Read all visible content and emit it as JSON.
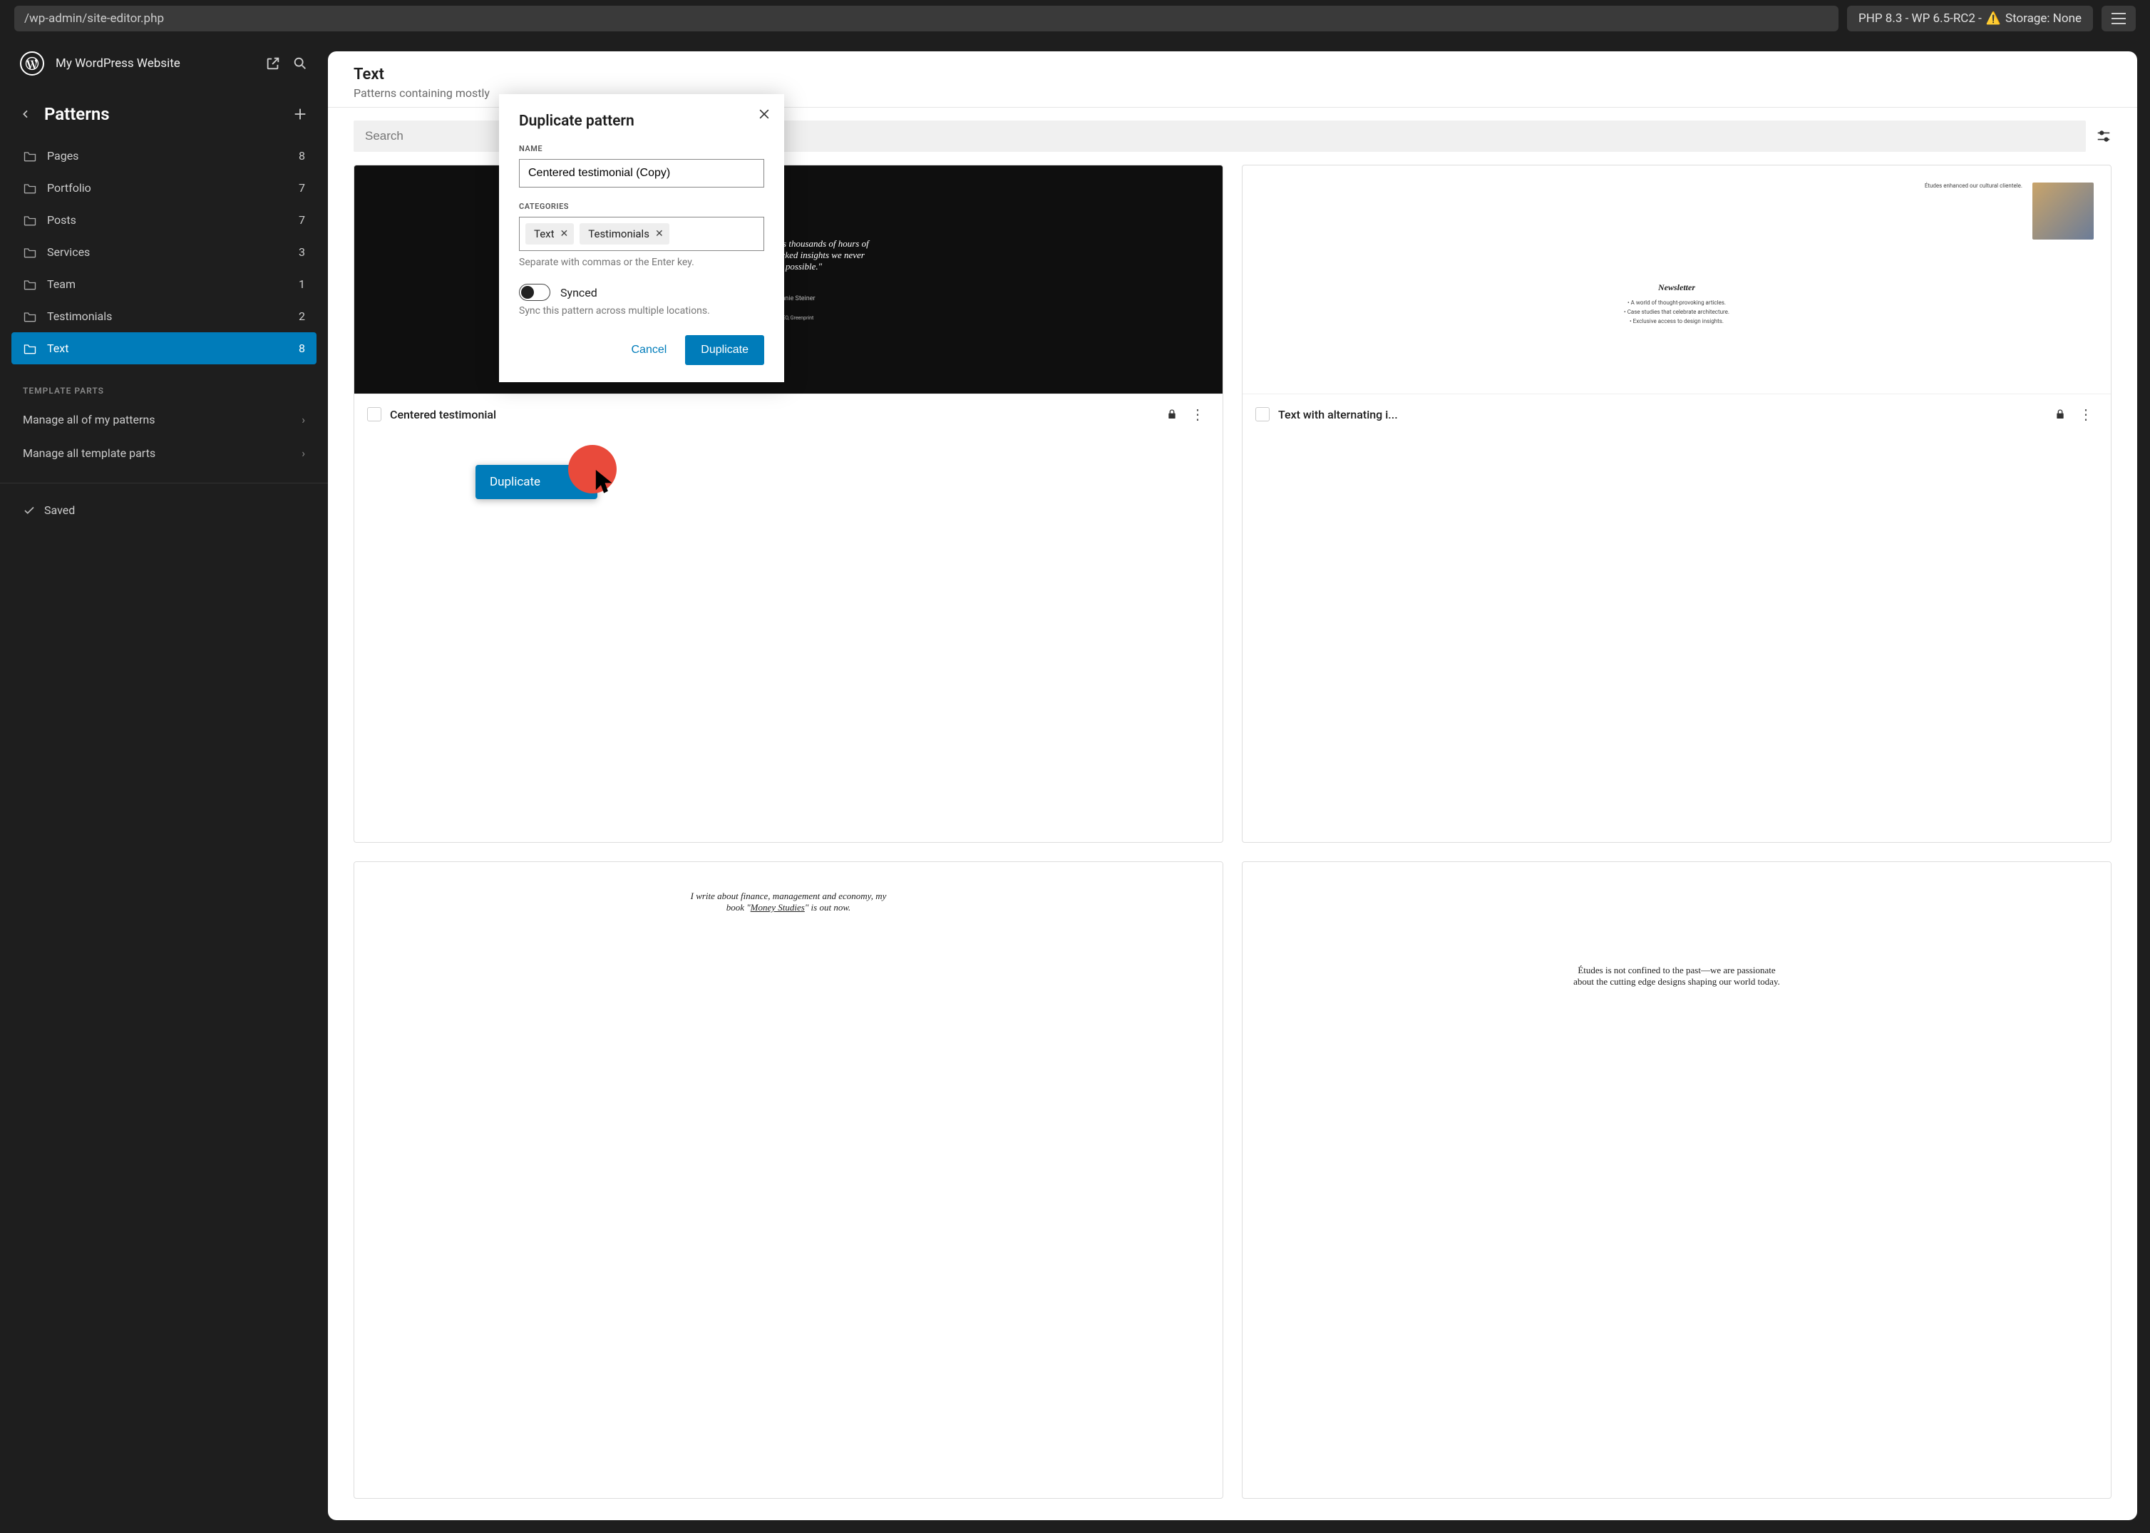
{
  "chrome": {
    "url": "/wp-admin/site-editor.php",
    "env": "PHP 8.3 - WP 6.5-RC2 - ",
    "env_warn": "⚠️",
    "env_storage": " Storage: None"
  },
  "sidebar": {
    "site_title": "My WordPress Website",
    "nav_title": "Patterns",
    "categories": [
      {
        "label": "Pages",
        "count": "8"
      },
      {
        "label": "Portfolio",
        "count": "7"
      },
      {
        "label": "Posts",
        "count": "7"
      },
      {
        "label": "Services",
        "count": "3"
      },
      {
        "label": "Team",
        "count": "1"
      },
      {
        "label": "Testimonials",
        "count": "2"
      },
      {
        "label": "Text",
        "count": "8"
      }
    ],
    "template_parts_title": "TEMPLATE PARTS",
    "manage_patterns": "Manage all of my patterns",
    "manage_template_parts": "Manage all template parts",
    "saved": "Saved"
  },
  "panel": {
    "title": "Text",
    "subtitle": "Patterns containing mostly",
    "search_placeholder": "Search",
    "cards": {
      "0": {
        "title": "Centered testimonial",
        "preview_quote": "\"Études has saved us thousands of hours of work and has unlocked insights we never thought possible.\"",
        "preview_author": "Annie Steiner",
        "preview_role": "CEO, Greenprint"
      },
      "1": {
        "title": "Text with alternating i...",
        "small1": "Études enhanced our cultural clientele.",
        "news": "Newsletter",
        "small2": "A world of thought-provoking articles.",
        "small3": "Case studies that celebrate architecture.",
        "small4": "Exclusive access to design insights."
      },
      "2": {
        "preview_body_a": "I write about finance, management and economy, my book \"",
        "preview_body_u": "Money Studies",
        "preview_body_b": "\" is out now."
      },
      "3": {
        "preview_body": "Études is not confined to the past—we are passionate about the cutting edge designs shaping our world today."
      }
    },
    "menu_option": "Duplicate"
  },
  "modal": {
    "title": "Duplicate pattern",
    "name_label": "NAME",
    "name_value": "Centered testimonial (Copy)",
    "cat_label": "CATEGORIES",
    "tokens": {
      "0": "Text",
      "1": "Testimonials"
    },
    "cat_hint": "Separate with commas or the Enter key.",
    "toggle_label": "Synced",
    "toggle_hint": "Sync this pattern across multiple locations.",
    "cancel": "Cancel",
    "confirm": "Duplicate"
  }
}
